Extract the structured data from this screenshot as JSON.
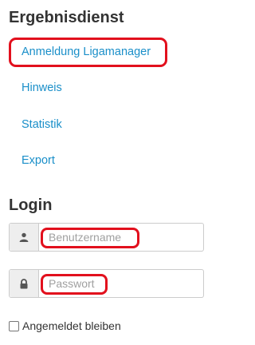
{
  "results": {
    "title": "Ergebnisdienst",
    "links": [
      {
        "label": "Anmeldung Ligamanager"
      },
      {
        "label": "Hinweis"
      },
      {
        "label": "Statistik"
      },
      {
        "label": "Export"
      }
    ]
  },
  "login": {
    "title": "Login",
    "username": {
      "placeholder": "Benutzername",
      "value": "",
      "icon": "user-icon"
    },
    "password": {
      "placeholder": "Passwort",
      "value": "",
      "icon": "lock-icon"
    },
    "remember_label": "Angemeldet bleiben",
    "remember_checked": false
  },
  "colors": {
    "link": "#1a8fc9",
    "highlight": "#e2101d",
    "text": "#333333"
  }
}
